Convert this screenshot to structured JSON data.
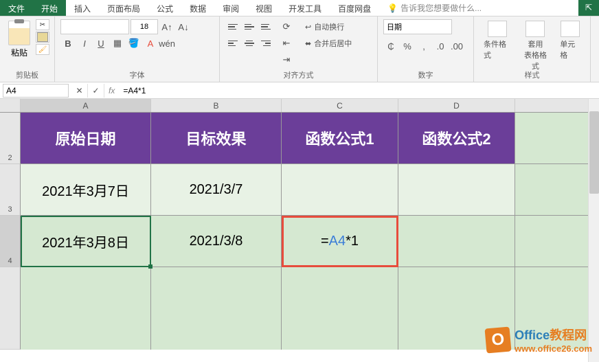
{
  "tabs": {
    "file": "文件",
    "home": "开始",
    "insert": "插入",
    "layout": "页面布局",
    "formulas": "公式",
    "data": "数据",
    "review": "审阅",
    "view": "视图",
    "dev": "开发工具",
    "baidu": "百度网盘",
    "tell": "告诉我您想要做什么..."
  },
  "ribbon": {
    "clipboard": {
      "label": "剪贴板",
      "paste": "粘贴"
    },
    "font": {
      "label": "字体",
      "size": "18",
      "B": "B",
      "I": "I",
      "U": "U"
    },
    "align": {
      "label": "对齐方式",
      "wrap": "自动换行",
      "merge": "合并后居中"
    },
    "number": {
      "label": "数字",
      "format": "日期"
    },
    "styles": {
      "label": "样式",
      "cond": "条件格式",
      "table": "套用\n表格格式",
      "cell": "单元格"
    }
  },
  "formula_bar": {
    "cell_ref": "A4",
    "formula": "=A4*1"
  },
  "columns": {
    "A": "A",
    "B": "B",
    "C": "C",
    "D": "D"
  },
  "rows": {
    "r2": "2",
    "r3": "3",
    "r4": "4"
  },
  "table": {
    "headers": [
      "原始日期",
      "目标效果",
      "函数公式1",
      "函数公式2"
    ],
    "row1": [
      "2021年3月7日",
      "2021/3/7",
      "",
      ""
    ],
    "row2": [
      "2021年3月8日",
      "2021/3/8"
    ],
    "c4_formula_prefix": "=",
    "c4_formula_ref": "A4",
    "c4_formula_suffix": "*1"
  },
  "watermark": {
    "title_part1": "Office",
    "title_part2": "教程网",
    "url": "www.office26.com",
    "icon": "O"
  },
  "col_widths": {
    "A": 190,
    "B": 190,
    "C": 170,
    "D": 170
  },
  "row_heights": {
    "header": 75,
    "data": 75
  }
}
